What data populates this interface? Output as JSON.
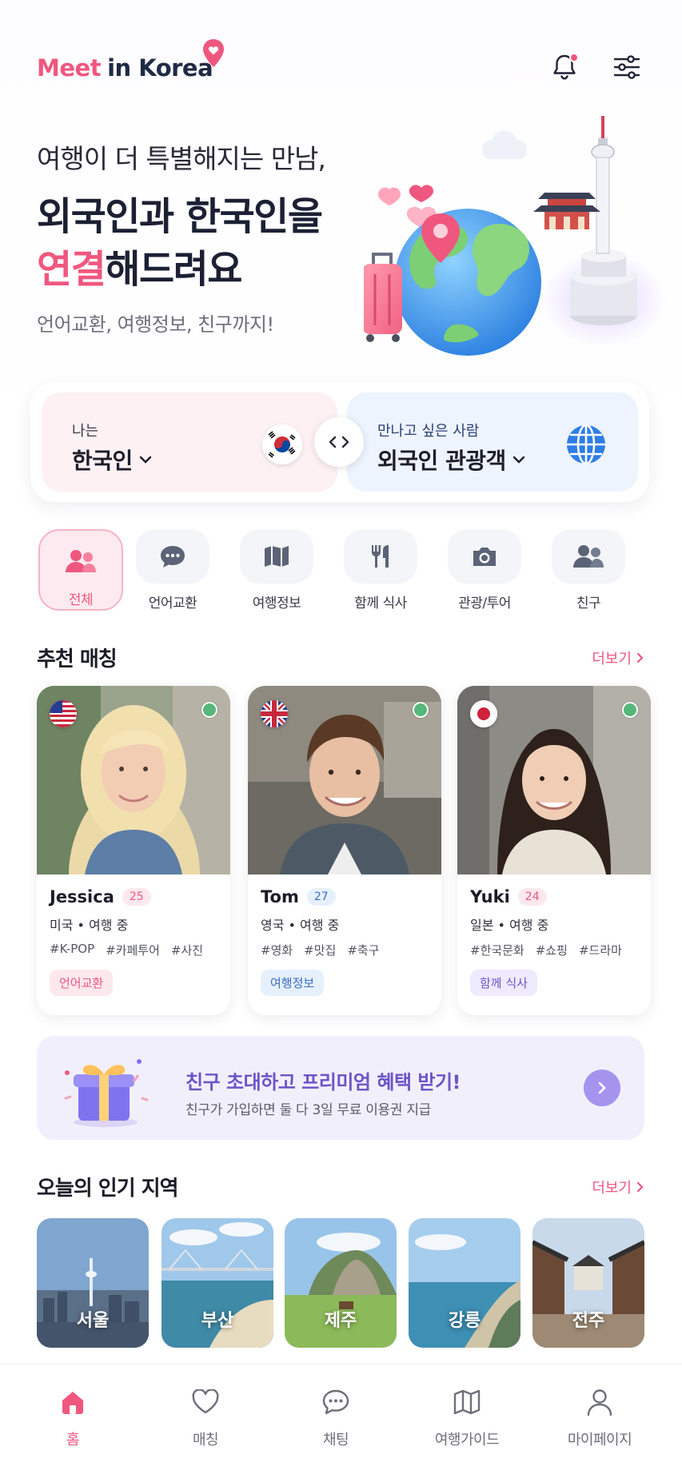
{
  "brand": {
    "meet": "Meet",
    "rest": "in Korea"
  },
  "colors": {
    "accent": "#f0577e",
    "navy": "#1f2b45",
    "purple": "#6a55c8"
  },
  "header": {
    "icons": [
      "bell-icon",
      "filter-icon"
    ]
  },
  "hero": {
    "subtitle": "여행이 더 특별해지는 만남,",
    "title_line1": "외국인과 한국인을",
    "title_line2_accent": "연결",
    "title_line2_rest": "해드려요",
    "description": "언어교환, 여행정보, 친구까지!"
  },
  "selector": {
    "left_label": "나는",
    "left_value": "한국인",
    "right_label": "만나고 싶은 사람",
    "right_value": "외국인 관광객"
  },
  "categories": [
    {
      "label": "전체",
      "icon": "people-icon",
      "active": true
    },
    {
      "label": "언어교환",
      "icon": "chat-icon"
    },
    {
      "label": "여행정보",
      "icon": "map-icon"
    },
    {
      "label": "함께 식사",
      "icon": "utensils-icon"
    },
    {
      "label": "관광/투어",
      "icon": "camera-icon"
    },
    {
      "label": "친구",
      "icon": "friends-icon"
    }
  ],
  "recommend": {
    "title": "추천 매칭",
    "more": "더보기"
  },
  "profiles": [
    {
      "name": "Jessica",
      "age": "25",
      "info": "미국 • 여행 중",
      "tags": [
        "#K-POP",
        "#카페투어",
        "#사진"
      ],
      "badge": "언어교환",
      "flag": "us"
    },
    {
      "name": "Tom",
      "age": "27",
      "info": "영국 • 여행 중",
      "tags": [
        "#영화",
        "#맛집",
        "#축구"
      ],
      "badge": "여행정보",
      "flag": "uk"
    },
    {
      "name": "Yuki",
      "age": "24",
      "info": "일본 • 여행 중",
      "tags": [
        "#한국문화",
        "#쇼핑",
        "#드라마"
      ],
      "badge": "함께 식사",
      "flag": "jp"
    }
  ],
  "banner": {
    "title": "친구 초대하고 프리미엄 혜택 받기!",
    "subtitle": "친구가 가입하면 둘 다 3일 무료 이용권 지급"
  },
  "popular": {
    "title": "오늘의 인기 지역",
    "more": "더보기"
  },
  "regions": [
    "서울",
    "부산",
    "제주",
    "강릉",
    "전주"
  ],
  "nav": [
    {
      "label": "홈",
      "icon": "home-icon",
      "active": true
    },
    {
      "label": "매칭",
      "icon": "heart-icon"
    },
    {
      "label": "채팅",
      "icon": "chat-bubble-icon"
    },
    {
      "label": "여행가이드",
      "icon": "map-icon"
    },
    {
      "label": "마이페이지",
      "icon": "user-icon"
    }
  ]
}
